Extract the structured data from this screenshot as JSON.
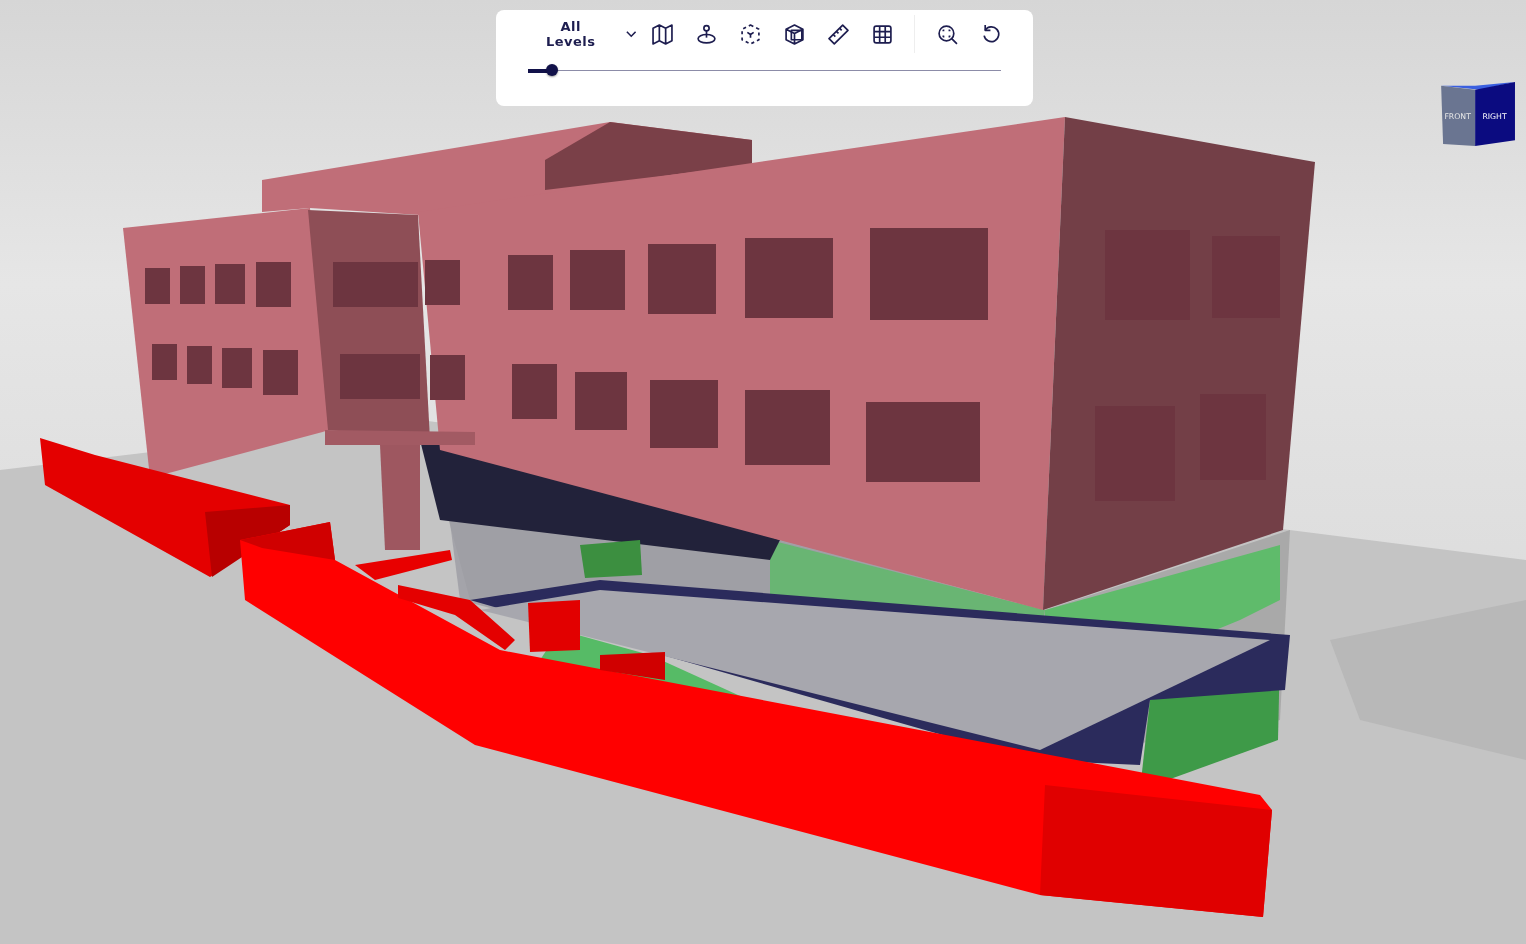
{
  "toolbar": {
    "level_select": {
      "value": "All Levels"
    },
    "slider": {
      "level": 0.05
    }
  },
  "view_cube": {
    "front": "FRONT",
    "right": "RIGHT"
  }
}
